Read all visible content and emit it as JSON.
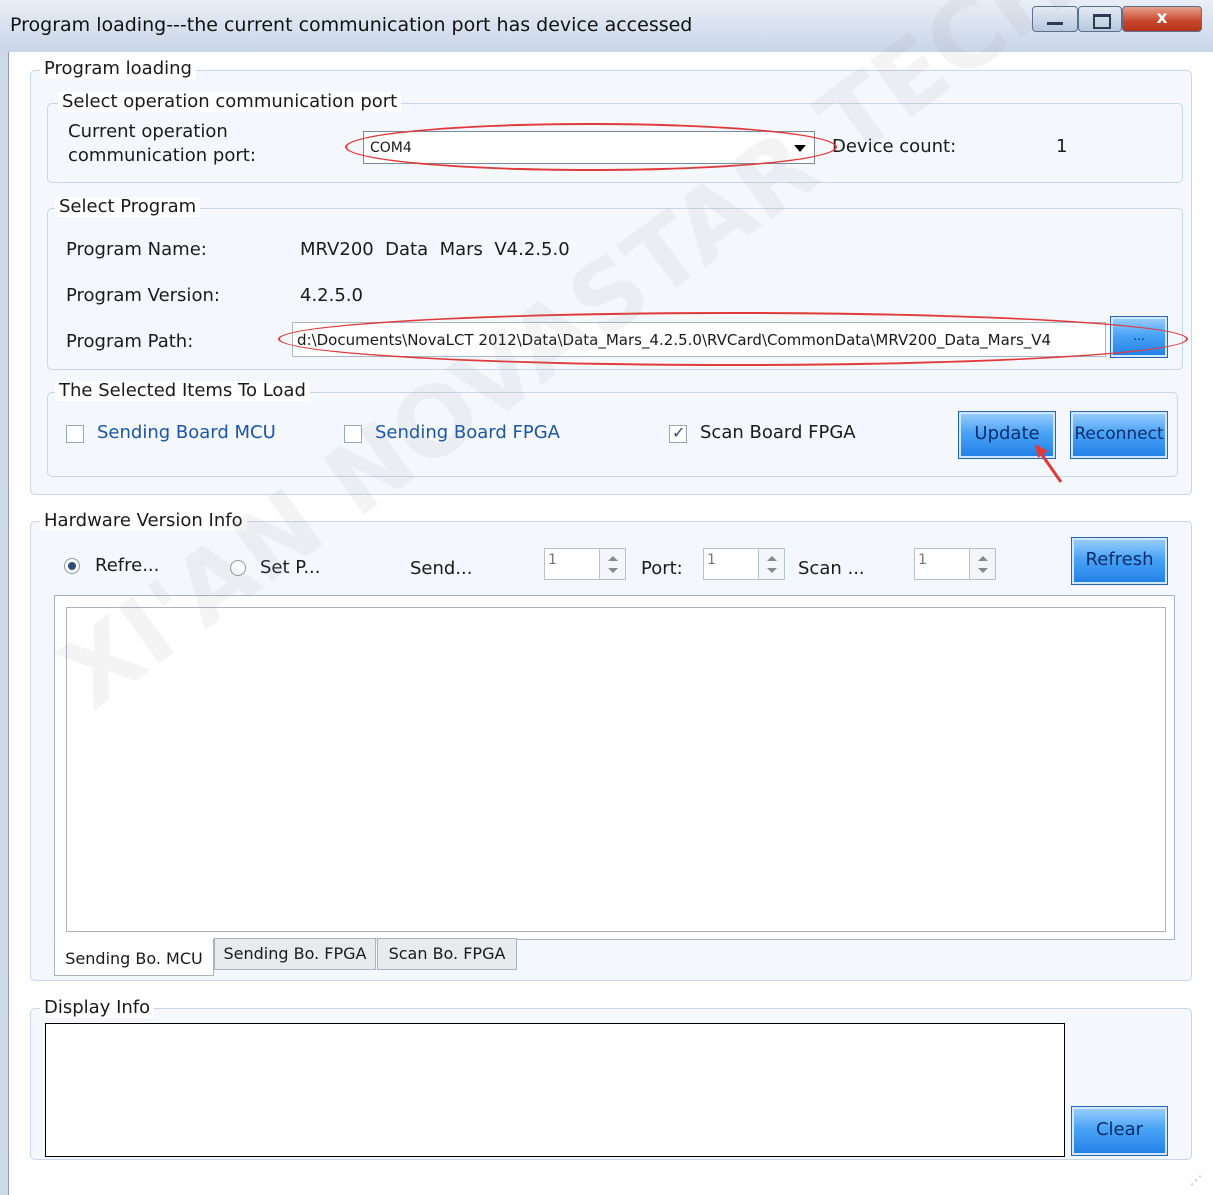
{
  "window": {
    "title": "Program loading---the current communication port has device accessed",
    "close_glyph": "x"
  },
  "program_loading": {
    "legend": "Program loading",
    "port_group": {
      "legend": "Select operation communication port",
      "current_port_label_line1": "Current operation",
      "current_port_label_line2": "communication port:",
      "current_port_value": "COM4",
      "device_count_label": "Device count:",
      "device_count_value": "1"
    },
    "program_group": {
      "legend": "Select Program",
      "name_label": "Program Name:",
      "name_value": "MRV200  Data  Mars  V4.2.5.0",
      "version_label": "Program Version:",
      "version_value": "4.2.5.0",
      "path_label": "Program Path:",
      "path_value": "d:\\Documents\\NovaLCT 2012\\Data\\Data_Mars_4.2.5.0\\RVCard\\CommonData\\MRV200_Data_Mars_V4",
      "browse_label": "..."
    },
    "items_group": {
      "legend": "The Selected Items To Load",
      "sending_mcu_label": "Sending Board MCU",
      "sending_mcu_checked": false,
      "sending_fpga_label": "Sending Board FPGA",
      "sending_fpga_checked": false,
      "scan_fpga_label": "Scan Board FPGA",
      "scan_fpga_checked": true,
      "update_label": "Update",
      "reconnect_label": "Reconnect"
    }
  },
  "hardware": {
    "legend": "Hardware Version Info",
    "refresh_all_label": "Refre...",
    "set_port_label": "Set P...",
    "send_label": "Send...",
    "send_value": "1",
    "port_label": "Port:",
    "port_value": "1",
    "scan_label": "Scan ...",
    "scan_value": "1",
    "refresh_button": "Refresh",
    "tabs": [
      "Sending Bo. MCU",
      "Sending Bo. FPGA",
      "Scan Bo. FPGA"
    ]
  },
  "display": {
    "legend": "Display Info",
    "clear_label": "Clear"
  },
  "watermark": "XI'AN NOVASTAR TECH CO., LTD",
  "colors": {
    "accent_blue": "#1f7fe6",
    "annotation_red": "#e03a3a",
    "label_blue": "#1a55a6"
  }
}
